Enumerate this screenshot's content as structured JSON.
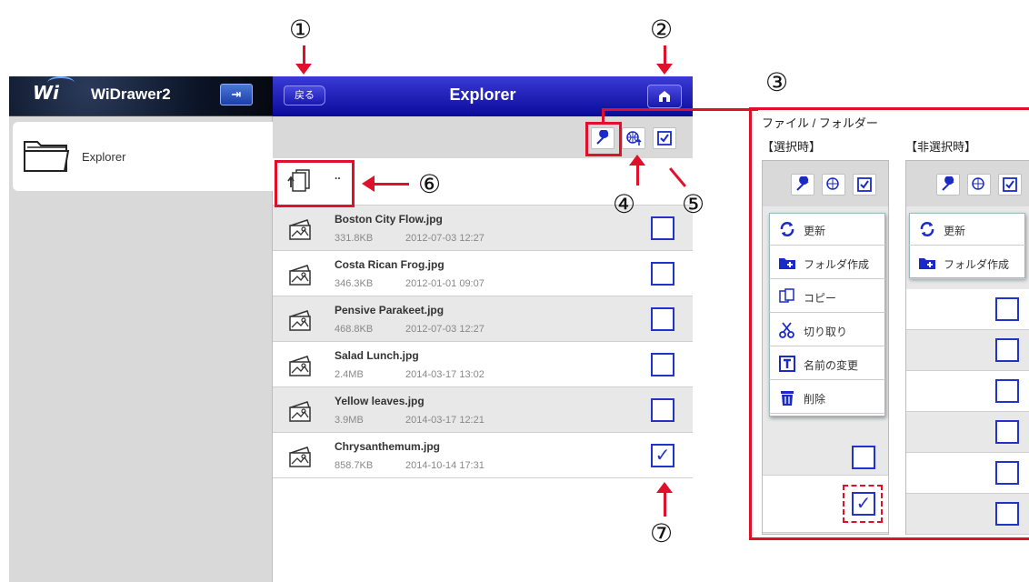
{
  "sidebar": {
    "logo_text": "Wi",
    "app_title": "WiDrawer2",
    "toggle_glyph": "⇥",
    "items": [
      {
        "label": "Explorer",
        "icon": "folder-icon"
      }
    ]
  },
  "explorer": {
    "back_label": "戻る",
    "title": "Explorer",
    "home_icon": "home-icon",
    "toolbar_icons": [
      "wrench-icon",
      "globe-upload-icon",
      "select-all-icon"
    ],
    "parent_label": "..",
    "files": [
      {
        "name": "Boston City Flow.jpg",
        "size": "331.8KB",
        "date": "2012-07-03 12:27",
        "checked": false
      },
      {
        "name": "Costa Rican Frog.jpg",
        "size": "346.3KB",
        "date": "2012-01-01 09:07",
        "checked": false
      },
      {
        "name": "Pensive Parakeet.jpg",
        "size": "468.8KB",
        "date": "2012-07-03 12:27",
        "checked": false
      },
      {
        "name": "Salad Lunch.jpg",
        "size": "2.4MB",
        "date": "2014-03-17 13:02",
        "checked": false
      },
      {
        "name": "Yellow leaves.jpg",
        "size": "3.9MB",
        "date": "2014-03-17 12:21",
        "checked": false
      },
      {
        "name": "Chrysanthemum.jpg",
        "size": "858.7KB",
        "date": "2014-10-14 17:31",
        "checked": true
      }
    ]
  },
  "callouts": [
    "①",
    "②",
    "③",
    "④",
    "⑤",
    "⑥",
    "⑦"
  ],
  "menu_panel": {
    "heading": "ファイル / フォルダー",
    "selected_label": "【選択時】",
    "unselected_label": "【非選択時】",
    "selected_menu": [
      {
        "label": "更新",
        "icon": "refresh-icon"
      },
      {
        "label": "フォルダ作成",
        "icon": "new-folder-icon"
      },
      {
        "label": "コピー",
        "icon": "copy-icon"
      },
      {
        "label": "切り取り",
        "icon": "scissors-icon"
      },
      {
        "label": "名前の変更",
        "icon": "rename-icon"
      },
      {
        "label": "削除",
        "icon": "trash-icon"
      }
    ],
    "unselected_menu": [
      {
        "label": "更新",
        "icon": "refresh-icon"
      },
      {
        "label": "フォルダ作成",
        "icon": "new-folder-icon"
      }
    ]
  },
  "colors": {
    "accent_red": "#e0102a",
    "nav_blue": "#0a0a9a",
    "check_blue": "#2233cc"
  },
  "check_glyph": "✓"
}
